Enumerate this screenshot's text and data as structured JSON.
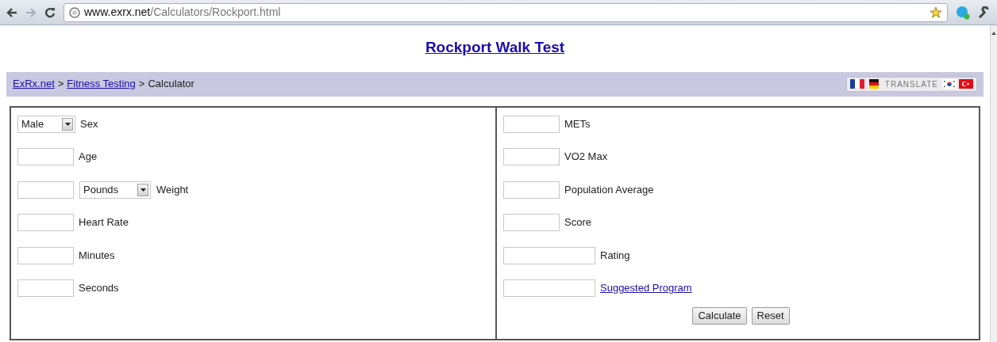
{
  "browser": {
    "url_host": "www.exrx.net",
    "url_path": "/Calculators/Rockport.html"
  },
  "page": {
    "title": "Rockport Walk Test",
    "breadcrumb": [
      {
        "kind": "link",
        "text": "ExRx.net"
      },
      {
        "kind": "separator",
        "text": ">"
      },
      {
        "kind": "link",
        "text": "Fitness Testing"
      },
      {
        "kind": "separator",
        "text": ">"
      },
      {
        "kind": "text",
        "text": "Calculator"
      }
    ],
    "translate": {
      "label": "TRANSLATE"
    },
    "left_fields": [
      {
        "kind": "select",
        "value": "Male",
        "label": "Sex"
      },
      {
        "kind": "input",
        "label": "Age"
      },
      {
        "kind": "input_select",
        "unit": "Pounds",
        "label": "Weight"
      },
      {
        "kind": "input",
        "label": "Heart Rate"
      },
      {
        "kind": "input",
        "label": "Minutes"
      },
      {
        "kind": "input",
        "label": "Seconds"
      }
    ],
    "right_fields": [
      {
        "kind": "input",
        "label": "METs"
      },
      {
        "kind": "input",
        "label": "VO2 Max"
      },
      {
        "kind": "input",
        "label": "Population Average"
      },
      {
        "kind": "input",
        "label": "Score"
      },
      {
        "kind": "wide_input",
        "label": "Rating"
      },
      {
        "kind": "wide_link",
        "label": "Suggested Program"
      }
    ],
    "buttons": [
      "Calculate",
      "Reset"
    ]
  }
}
